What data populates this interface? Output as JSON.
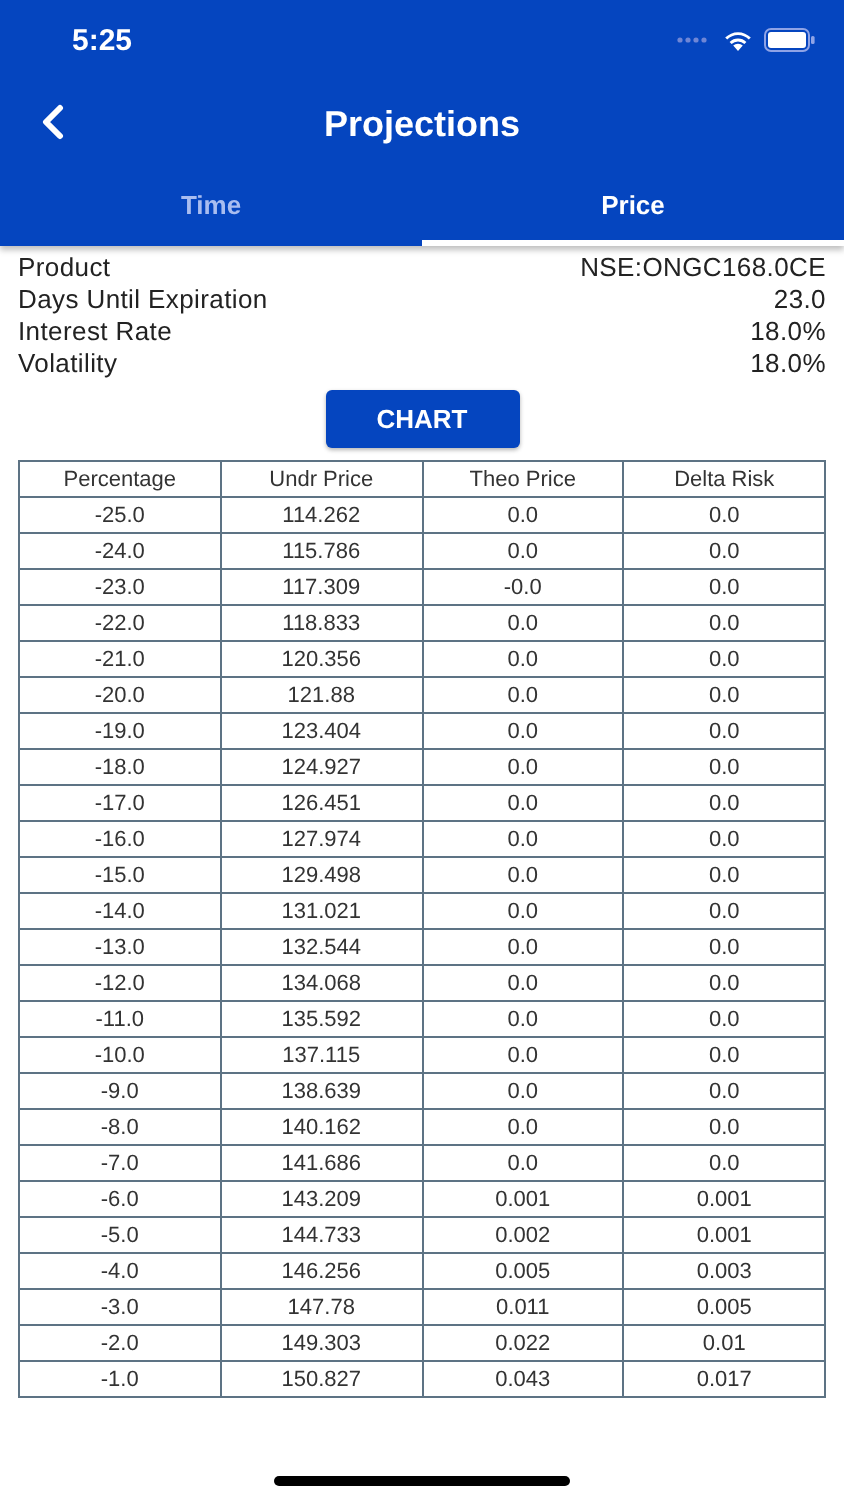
{
  "status_bar": {
    "time": "5:25"
  },
  "nav": {
    "title": "Projections"
  },
  "tabs": [
    {
      "label": "Time",
      "selected": false
    },
    {
      "label": "Price",
      "selected": true
    }
  ],
  "info": [
    {
      "label": "Product",
      "value": "NSE:ONGC168.0CE"
    },
    {
      "label": "Days Until Expiration",
      "value": "23.0"
    },
    {
      "label": "Interest Rate",
      "value": "18.0%"
    },
    {
      "label": "Volatility",
      "value": "18.0%"
    }
  ],
  "chart_button": "CHART",
  "table": {
    "columns": [
      "Percentage",
      "Undr Price",
      "Theo Price",
      "Delta Risk"
    ],
    "rows": [
      [
        "-25.0",
        "114.262",
        "0.0",
        "0.0"
      ],
      [
        "-24.0",
        "115.786",
        "0.0",
        "0.0"
      ],
      [
        "-23.0",
        "117.309",
        "-0.0",
        "0.0"
      ],
      [
        "-22.0",
        "118.833",
        "0.0",
        "0.0"
      ],
      [
        "-21.0",
        "120.356",
        "0.0",
        "0.0"
      ],
      [
        "-20.0",
        "121.88",
        "0.0",
        "0.0"
      ],
      [
        "-19.0",
        "123.404",
        "0.0",
        "0.0"
      ],
      [
        "-18.0",
        "124.927",
        "0.0",
        "0.0"
      ],
      [
        "-17.0",
        "126.451",
        "0.0",
        "0.0"
      ],
      [
        "-16.0",
        "127.974",
        "0.0",
        "0.0"
      ],
      [
        "-15.0",
        "129.498",
        "0.0",
        "0.0"
      ],
      [
        "-14.0",
        "131.021",
        "0.0",
        "0.0"
      ],
      [
        "-13.0",
        "132.544",
        "0.0",
        "0.0"
      ],
      [
        "-12.0",
        "134.068",
        "0.0",
        "0.0"
      ],
      [
        "-11.0",
        "135.592",
        "0.0",
        "0.0"
      ],
      [
        "-10.0",
        "137.115",
        "0.0",
        "0.0"
      ],
      [
        "-9.0",
        "138.639",
        "0.0",
        "0.0"
      ],
      [
        "-8.0",
        "140.162",
        "0.0",
        "0.0"
      ],
      [
        "-7.0",
        "141.686",
        "0.0",
        "0.0"
      ],
      [
        "-6.0",
        "143.209",
        "0.001",
        "0.001"
      ],
      [
        "-5.0",
        "144.733",
        "0.002",
        "0.001"
      ],
      [
        "-4.0",
        "146.256",
        "0.005",
        "0.003"
      ],
      [
        "-3.0",
        "147.78",
        "0.011",
        "0.005"
      ],
      [
        "-2.0",
        "149.303",
        "0.022",
        "0.01"
      ],
      [
        "-1.0",
        "150.827",
        "0.043",
        "0.017"
      ]
    ]
  }
}
